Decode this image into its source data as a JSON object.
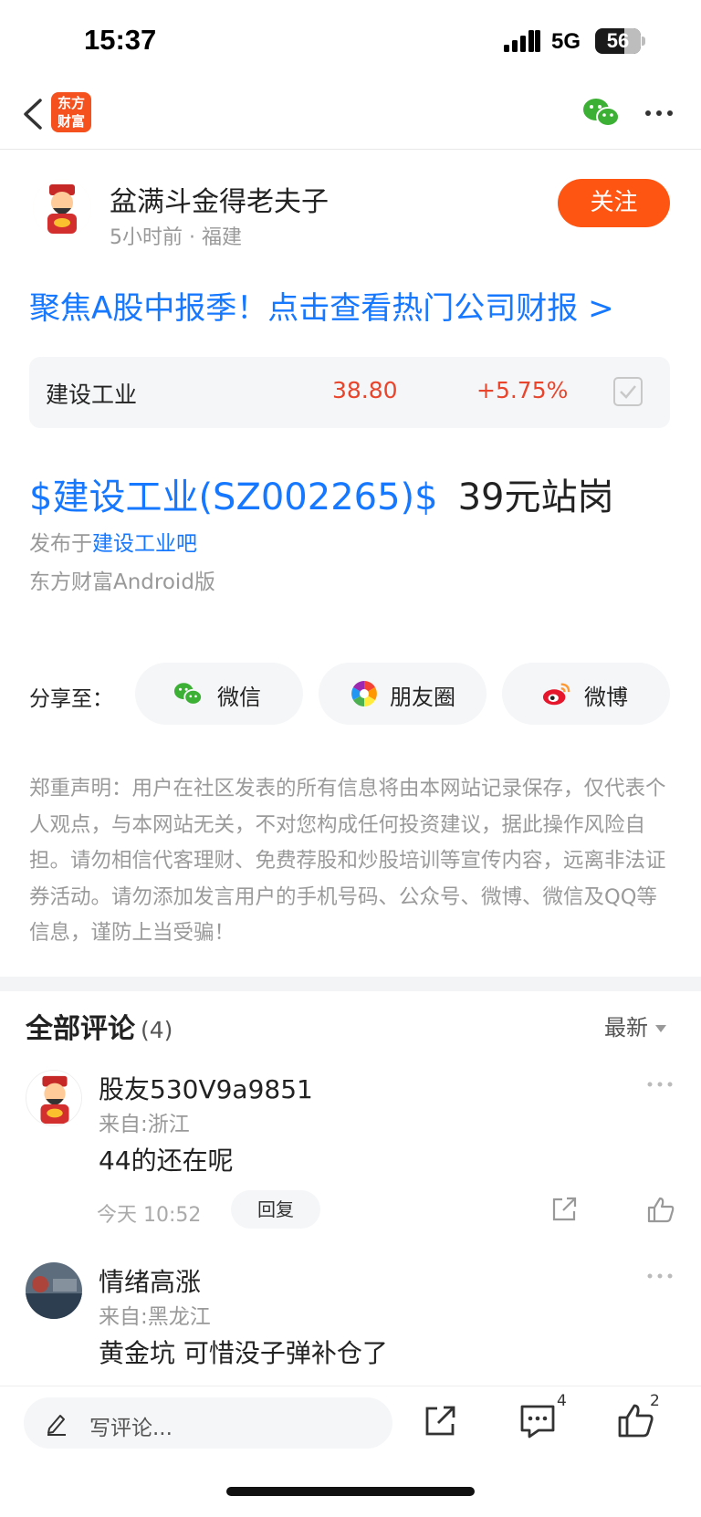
{
  "status_bar": {
    "time": "15:37",
    "network": "5G",
    "battery": "56"
  },
  "nav": {
    "logo_line1": "东方",
    "logo_line2": "财富"
  },
  "author": {
    "name": "盆满斗金得老夫子",
    "meta": "5小时前 · 福建",
    "follow_label": "关注"
  },
  "promo_link": "聚焦A股中报季！点击查看热门公司财报 >",
  "stock_card": {
    "name": "建设工业",
    "price": "38.80",
    "change": "+5.75%"
  },
  "post": {
    "stock_tag": "$建设工业(SZ002265)$",
    "text": "39元站岗"
  },
  "published": {
    "prefix": "发布于",
    "bar_link": "建设工业吧",
    "client": "东方财富Android版"
  },
  "share": {
    "label": "分享至：",
    "targets": [
      {
        "label": "微信",
        "icon": "wechat-icon"
      },
      {
        "label": "朋友圈",
        "icon": "moments-icon"
      },
      {
        "label": "微博",
        "icon": "weibo-icon"
      }
    ]
  },
  "disclaimer": "郑重声明：用户在社区发表的所有信息将由本网站记录保存，仅代表个人观点，与本网站无关，不对您构成任何投资建议，据此操作风险自担。请勿相信代客理财、免费荐股和炒股培训等宣传内容，远离非法证券活动。请勿添加发言用户的手机号码、公众号、微博、微信及QQ等信息，谨防上当受骗！",
  "comments": {
    "title": "全部评论",
    "count": "(4)",
    "sort_label": "最新",
    "items": [
      {
        "user": "股友530V9a9851",
        "location": "来自:浙江",
        "text": "44的还在呢",
        "time": "今天 10:52",
        "reply_label": "回复"
      },
      {
        "user": "情绪高涨",
        "location": "来自:黑龙江",
        "text": "黄金坑 可惜没子弹补仓了"
      }
    ]
  },
  "bottom_bar": {
    "input_placeholder": "写评论...",
    "comment_count": "4",
    "like_count": "2"
  },
  "colors": {
    "accent_orange": "#ff5512",
    "link_blue": "#1677ff",
    "price_red": "#e8452c",
    "wechat_green": "#3cb034"
  }
}
